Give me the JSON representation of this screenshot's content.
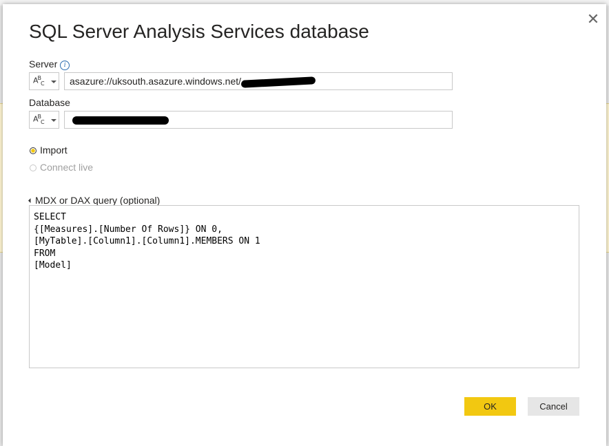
{
  "dialog": {
    "title": "SQL Server Analysis Services database",
    "close_icon": "close-icon"
  },
  "server": {
    "label": "Server",
    "info_icon": "info-icon",
    "type_icon": "text-type-icon",
    "value": "asazure://uksouth.asazure.windows.net/"
  },
  "database": {
    "label": "Database",
    "type_icon": "text-type-icon",
    "value": ""
  },
  "mode": {
    "options": [
      {
        "label": "Import",
        "selected": true,
        "enabled": true
      },
      {
        "label": "Connect live",
        "selected": false,
        "enabled": false
      }
    ]
  },
  "query": {
    "toggle_label": "MDX or DAX query (optional)",
    "expanded": true,
    "lines": [
      "SELECT",
      "{[Measures].[Number Of Rows]} ON 0,",
      "[MyTable].[Column1].[Column1].MEMBERS ON 1",
      "FROM",
      "[Model]"
    ]
  },
  "buttons": {
    "ok_label": "OK",
    "cancel_label": "Cancel"
  },
  "colors": {
    "accent": "#f2c811",
    "info": "#2b6cb0"
  }
}
